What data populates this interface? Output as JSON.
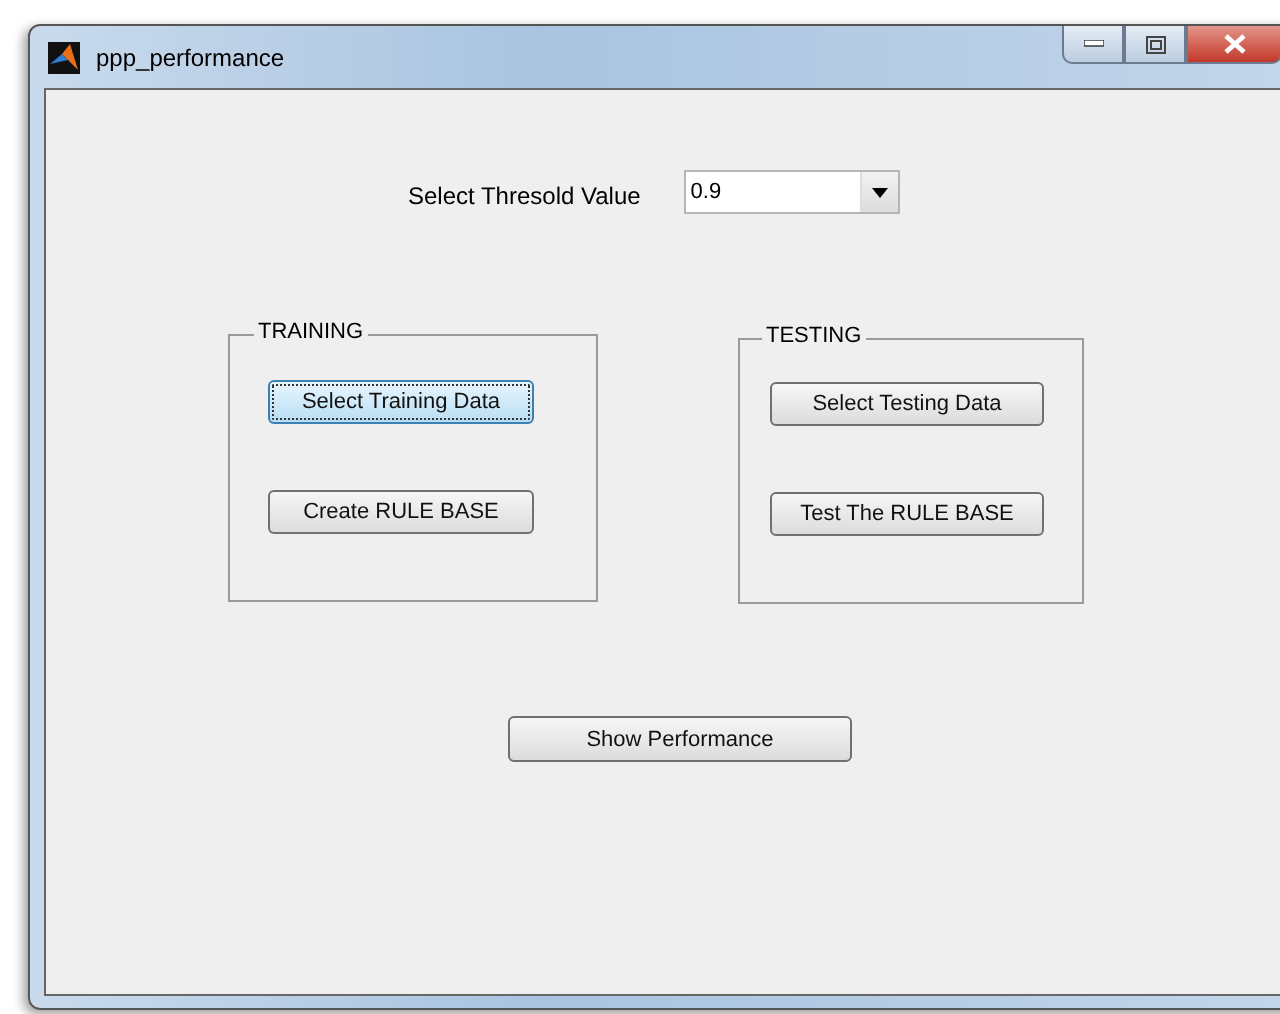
{
  "window": {
    "title": "ppp_performance"
  },
  "threshold": {
    "label": "Select Thresold Value",
    "value": "0.9"
  },
  "panels": [
    {
      "title": "TRAINING",
      "buttons": [
        {
          "label": "Select Training Data",
          "focused": true
        },
        {
          "label": "Create RULE BASE",
          "focused": false
        }
      ]
    },
    {
      "title": "TESTING",
      "buttons": [
        {
          "label": "Select Testing Data",
          "focused": false
        },
        {
          "label": "Test The RULE BASE",
          "focused": false
        }
      ]
    }
  ],
  "action": {
    "label": "Show Performance",
    "focused": false
  }
}
